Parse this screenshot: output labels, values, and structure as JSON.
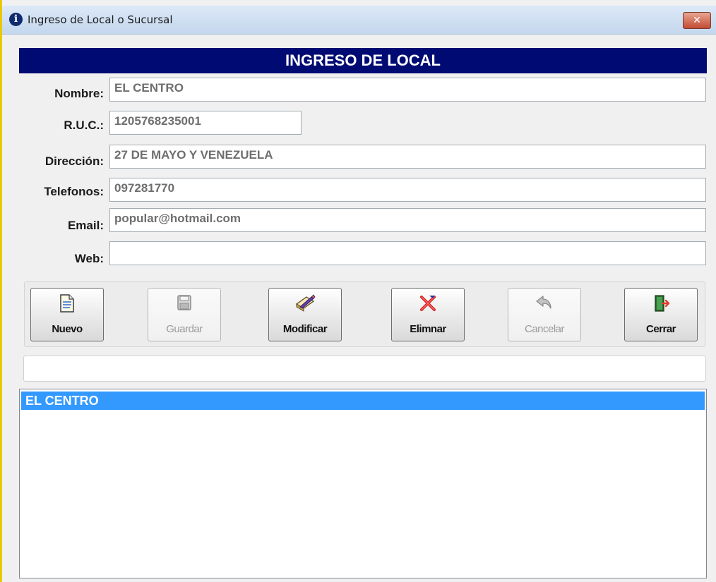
{
  "window": {
    "title": "Ingreso de Local o Sucursal",
    "close_glyph": "✕"
  },
  "form": {
    "header": "INGRESO DE LOCAL",
    "fields": {
      "nombre": {
        "label": "Nombre:",
        "value": "EL CENTRO"
      },
      "ruc": {
        "label": "R.U.C.:",
        "value": "1205768235001"
      },
      "direccion": {
        "label": "Dirección:",
        "value": "27 DE MAYO Y VENEZUELA"
      },
      "telefonos": {
        "label": "Telefonos:",
        "value": "097281770"
      },
      "email": {
        "label": "Email:",
        "value": "popular@hotmail.com"
      },
      "web": {
        "label": "Web:",
        "value": ""
      }
    }
  },
  "toolbar": {
    "nuevo": {
      "label": "Nuevo",
      "icon": "document-icon",
      "enabled": true
    },
    "guardar": {
      "label": "Guardar",
      "icon": "save-icon",
      "enabled": false
    },
    "modificar": {
      "label": "Modificar",
      "icon": "edit-icon",
      "enabled": true
    },
    "eliminar": {
      "label": "Elimnar",
      "icon": "delete-x-icon",
      "enabled": true
    },
    "cancelar": {
      "label": "Cancelar",
      "icon": "undo-arrow-icon",
      "enabled": false
    },
    "cerrar": {
      "label": "Cerrar",
      "icon": "exit-door-icon",
      "enabled": true
    }
  },
  "status": {
    "value": ""
  },
  "list": {
    "items": [
      {
        "label": "EL CENTRO",
        "selected": true
      }
    ]
  },
  "colors": {
    "header_bg": "#000a73",
    "selection": "#3399ff",
    "close_button": "#c24c34"
  }
}
